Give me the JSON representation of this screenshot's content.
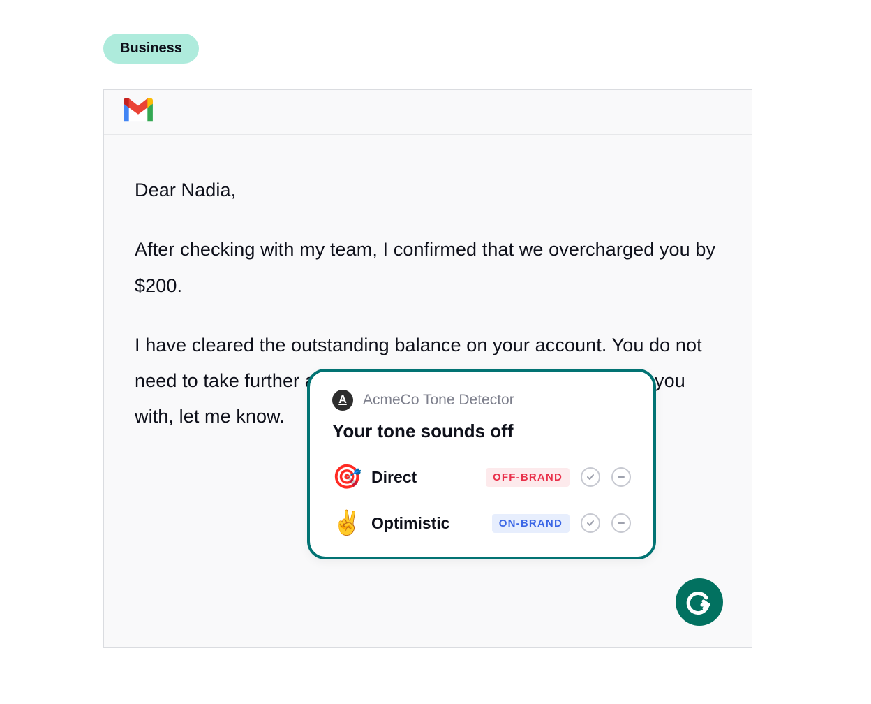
{
  "badge": {
    "label": "Business"
  },
  "email": {
    "greeting": "Dear Nadia,",
    "para1": "After checking with my team, I confirmed that we overcharged you by $200.",
    "para2": "I have cleared the outstanding balance on your account. You do not need to take further action. If there is anything else I can help you with, let me know."
  },
  "popup": {
    "brand_letter": "A",
    "subtitle": "AcmeCo Tone Detector",
    "title": "Your tone sounds off",
    "tones": [
      {
        "emoji": "🎯",
        "label": "Direct",
        "badge": "OFF-BRAND",
        "brand": "off"
      },
      {
        "emoji": "✌️",
        "label": "Optimistic",
        "badge": "ON-BRAND",
        "brand": "on"
      }
    ]
  }
}
